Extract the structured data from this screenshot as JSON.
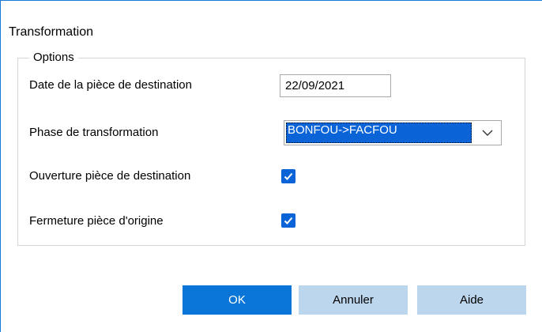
{
  "dialog": {
    "title": "Transformation"
  },
  "options": {
    "group_title": "Options",
    "date_label": "Date de la pièce de destination",
    "date_value": "22/09/2021",
    "phase_label": "Phase de transformation",
    "phase_value": "BONFOU->FACFOU",
    "open_dest_label": "Ouverture pièce de destination",
    "open_dest_checked": true,
    "close_origin_label": "Fermeture pièce d'origine",
    "close_origin_checked": true
  },
  "buttons": {
    "ok": "OK",
    "cancel": "Annuler",
    "help": "Aide"
  },
  "colors": {
    "accent": "#0a64d8",
    "primary_button": "#0a75d8",
    "secondary_button": "#bcd6ee",
    "window_border": "#1a7bd6"
  },
  "icons": {
    "dropdown": "chevron-down-icon",
    "check": "checkmark-icon"
  }
}
